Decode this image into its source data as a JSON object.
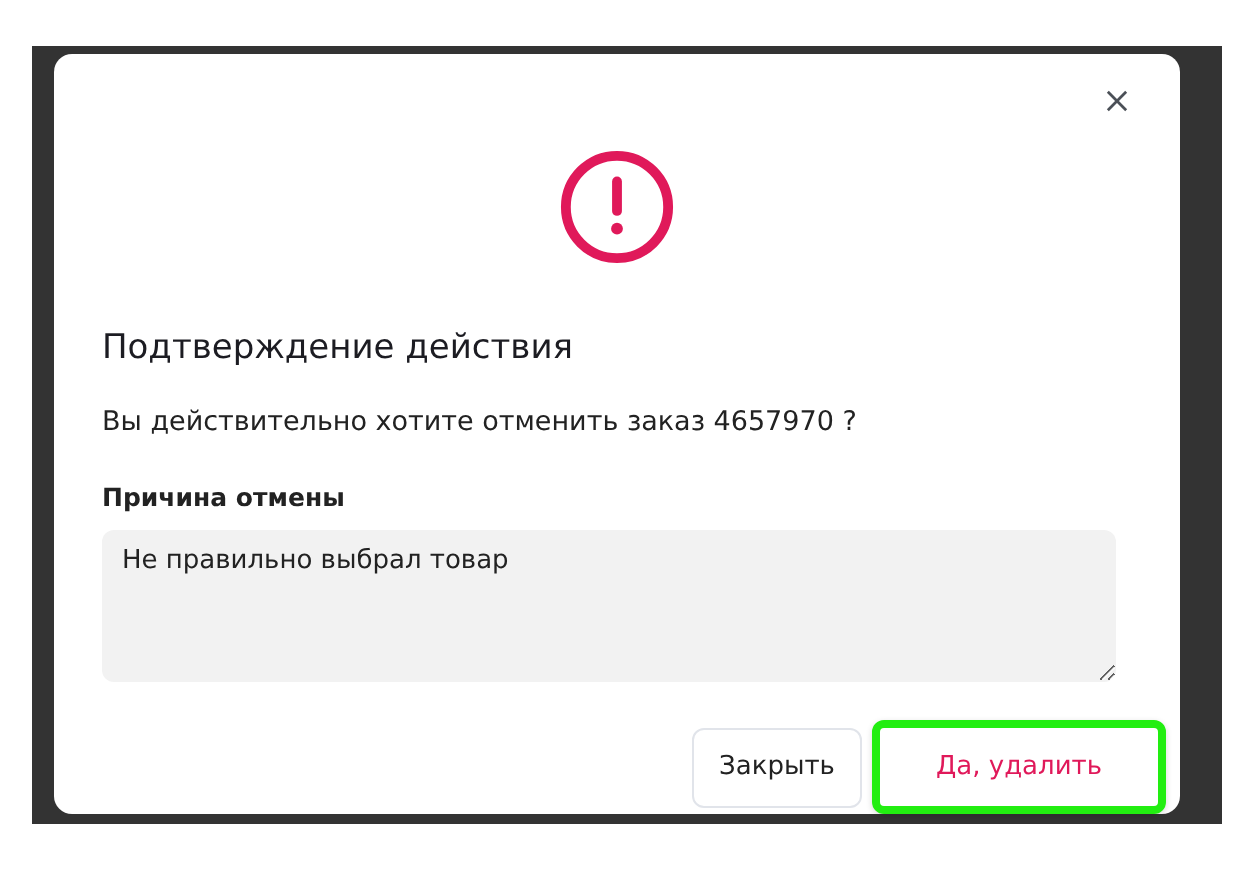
{
  "dialog": {
    "title": "Подтверждение действия",
    "message": "Вы действительно хотите отменить заказ 4657970 ?",
    "reason_label": "Причина отмены",
    "reason_value": "Не правильно выбрал товар",
    "buttons": [
      {
        "label": "Закрыть",
        "kind": "secondary",
        "highlighted": false
      },
      {
        "label": "Да, удалить",
        "kind": "danger",
        "highlighted": true
      }
    ]
  }
}
